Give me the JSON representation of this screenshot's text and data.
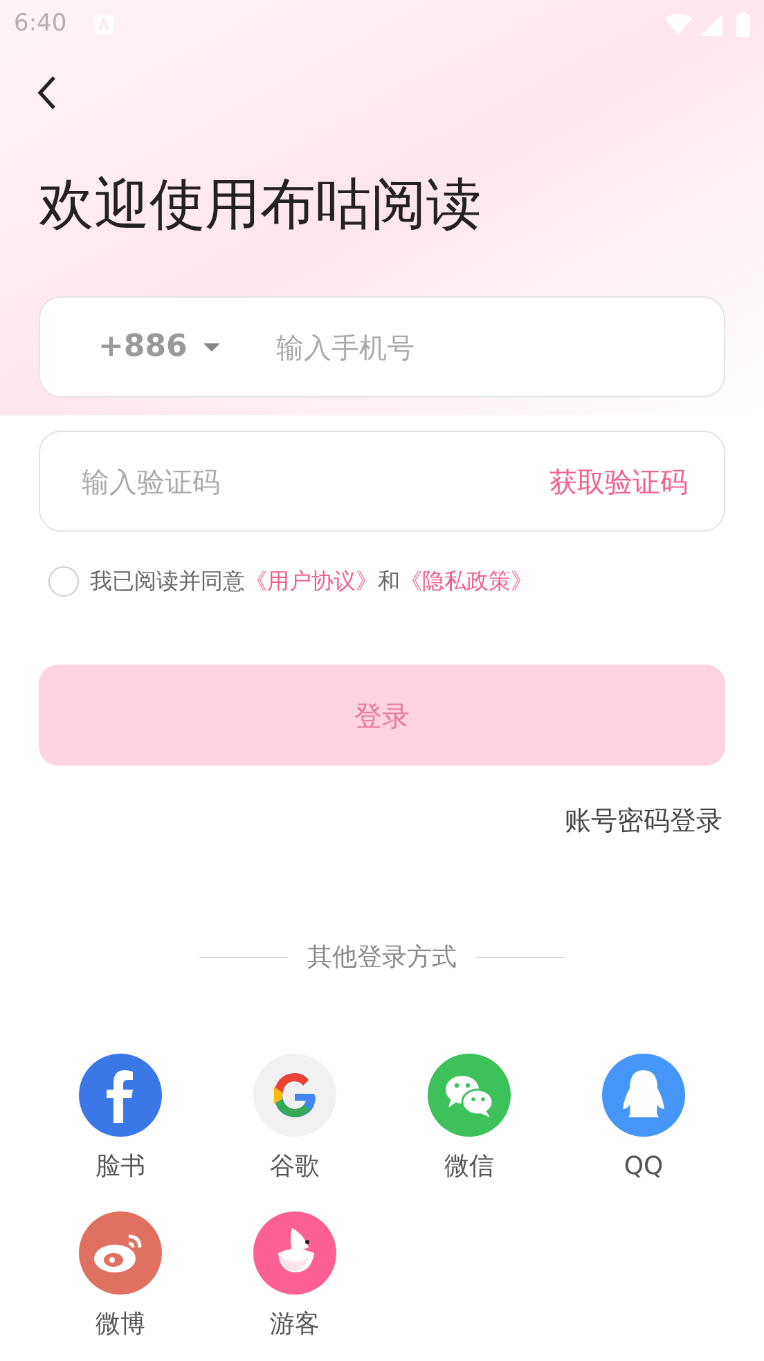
{
  "status_bar": {
    "time": "6:40"
  },
  "title": "欢迎使用布咕阅读",
  "phone": {
    "country_code": "+886",
    "placeholder": "输入手机号"
  },
  "code": {
    "placeholder": "输入验证码",
    "action": "获取验证码"
  },
  "agreement": {
    "checked": false,
    "text": "我已阅读并同意",
    "link_1": "《用户协议》",
    "joiner": "和",
    "link_2": "《隐私政策》"
  },
  "login_button": {
    "label": "登录",
    "disabled": true
  },
  "password_login": "账号密码登录",
  "other_methods": "其他登录方式",
  "methods": [
    {
      "kind": "facebook",
      "label": "脸书",
      "color": "#3b78e7"
    },
    {
      "kind": "google",
      "label": "谷歌",
      "color": "#f1f1f1"
    },
    {
      "kind": "wechat",
      "label": "微信",
      "color": "#3cc15b"
    },
    {
      "kind": "qq",
      "label": "QQ",
      "color": "#4596f7"
    },
    {
      "kind": "weibo",
      "label": "微博",
      "color": "#e07060"
    },
    {
      "kind": "guest",
      "label": "游客",
      "color": "#fe5f94"
    }
  ]
}
